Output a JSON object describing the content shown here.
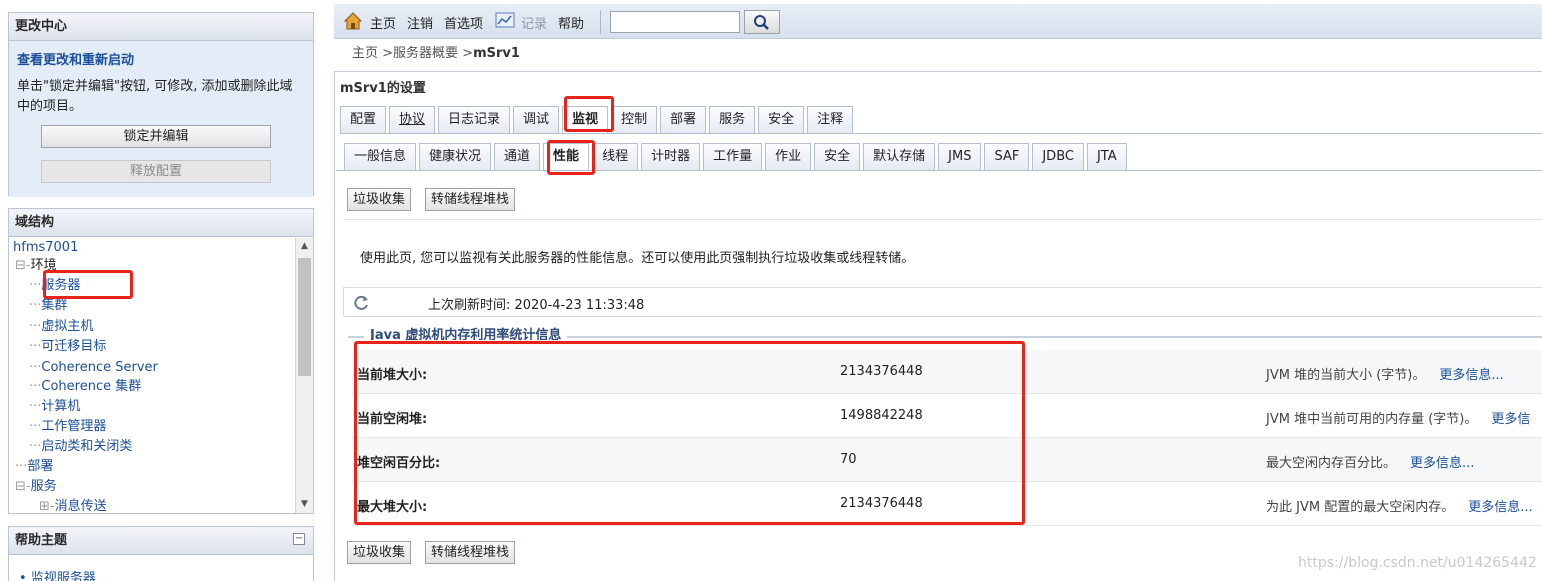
{
  "change_center": {
    "title": "更改中心",
    "view_changes_link": "查看更改和重新启动",
    "description": "单击\"锁定并编辑\"按钮, 可修改, 添加或删除此域中的项目。",
    "lock_button": "锁定并编辑",
    "release_button": "释放配置"
  },
  "domain_structure": {
    "title": "域结构",
    "root": "hfms7001",
    "items": [
      {
        "prefix": "",
        "label": "hfms7001",
        "link": true
      },
      {
        "prefix": "⊟-",
        "label": "环境",
        "link": false
      },
      {
        "prefix": "··",
        "label": "服务器",
        "link": true
      },
      {
        "prefix": "··",
        "label": "集群",
        "link": true
      },
      {
        "prefix": "··",
        "label": "虚拟主机",
        "link": true
      },
      {
        "prefix": "··",
        "label": "可迁移目标",
        "link": true
      },
      {
        "prefix": "··",
        "label": "Coherence Server",
        "link": true
      },
      {
        "prefix": "··",
        "label": "Coherence 集群",
        "link": true
      },
      {
        "prefix": "··",
        "label": "计算机",
        "link": true
      },
      {
        "prefix": "··",
        "label": "工作管理器",
        "link": true
      },
      {
        "prefix": "··",
        "label": "启动类和关闭类",
        "link": true
      },
      {
        "prefix": "··",
        "label": "部署",
        "link": false
      },
      {
        "prefix": "⊟-",
        "label": "服务",
        "link": false
      },
      {
        "prefix": "⊞-",
        "label": "消息传送",
        "link": true
      }
    ]
  },
  "help": {
    "title": "帮助主题",
    "items": [
      "监视服务器"
    ]
  },
  "toolbar": {
    "home": "主页",
    "logout": "注销",
    "preferences": "首选项",
    "record": "记录",
    "help": "帮助",
    "search_value": ""
  },
  "breadcrumb": {
    "prefix": "主页 >服务器概要 >",
    "current": "mSrv1"
  },
  "settings_title": "mSrv1的设置",
  "main_tabs": [
    "配置",
    "协议",
    "日志记录",
    "调试",
    "监视",
    "控制",
    "部署",
    "服务",
    "安全",
    "注释"
  ],
  "main_tab_active": "监视",
  "sub_tabs": [
    "一般信息",
    "健康状况",
    "通道",
    "性能",
    "线程",
    "计时器",
    "工作量",
    "作业",
    "安全",
    "默认存储",
    "JMS",
    "SAF",
    "JDBC",
    "JTA"
  ],
  "sub_tab_active": "性能",
  "actions": {
    "gc": "垃圾收集",
    "dump": "转储线程堆栈"
  },
  "intro": "使用此页, 您可以监视有关此服务器的性能信息。还可以使用此页强制执行垃圾收集或线程转储。",
  "refresh": {
    "label": "上次刷新时间: 2020-4-23 11:33:48"
  },
  "jvm_section": {
    "legend": "Java 虚拟机内存利用率统计信息",
    "rows": [
      {
        "label": "当前堆大小:",
        "value": "2134376448",
        "desc": "JVM 堆的当前大小 (字节)。",
        "more": "更多信息..."
      },
      {
        "label": "当前空闲堆:",
        "value": "1498842248",
        "desc": "JVM 堆中当前可用的内存量 (字节)。",
        "more": "更多信"
      },
      {
        "label": "堆空闲百分比:",
        "value": "70",
        "desc": "最大空闲内存百分比。",
        "more": "更多信息..."
      },
      {
        "label": "最大堆大小:",
        "value": "2134376448",
        "desc": "为此 JVM 配置的最大空闲内存。",
        "more": "更多信息..."
      }
    ]
  },
  "watermark": "https://blog.csdn.net/u014265442",
  "colors": {
    "highlight": "#e8231a",
    "link": "#1b4f9c"
  }
}
